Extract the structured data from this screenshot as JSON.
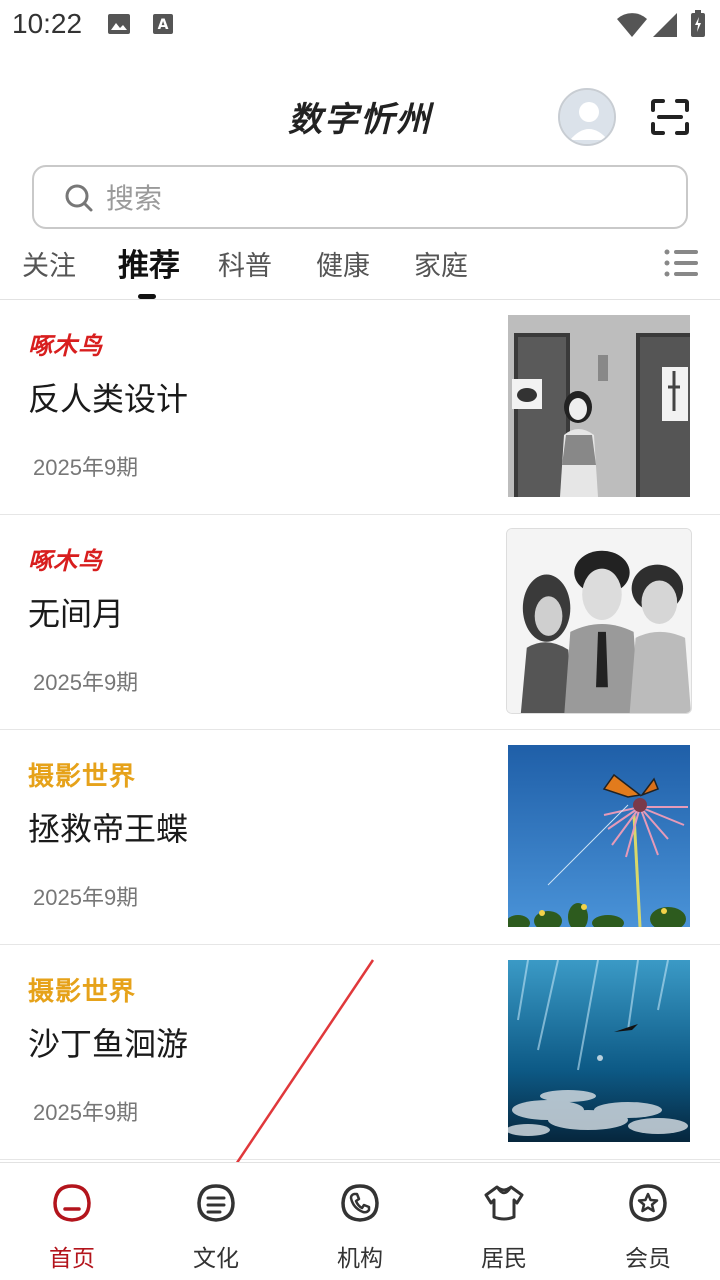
{
  "status_bar": {
    "time": "10:22",
    "icons": [
      "image-icon",
      "a-icon",
      "wifi-icon",
      "signal-icon",
      "battery-icon"
    ]
  },
  "header": {
    "title": "数字忻州",
    "avatar_icon": "avatar-icon",
    "scan_icon": "scan-icon"
  },
  "search": {
    "placeholder": "搜索"
  },
  "tabs": {
    "items": [
      {
        "label": "关注"
      },
      {
        "label": "推荐",
        "active": true
      },
      {
        "label": "科普"
      },
      {
        "label": "健康"
      },
      {
        "label": "家庭"
      }
    ],
    "menu_icon": "list-menu-icon"
  },
  "articles": [
    {
      "source": "啄木鸟",
      "title": "反人类设计",
      "date": "2025年9期"
    },
    {
      "source": "啄木鸟",
      "title": "无间月",
      "date": "2025年9期"
    },
    {
      "source": "摄影世界",
      "title": "拯救帝王蝶",
      "date": "2025年9期"
    },
    {
      "source": "摄影世界",
      "title": "沙丁鱼洄游",
      "date": "2025年9期"
    }
  ],
  "bottom_nav": {
    "items": [
      {
        "label": "首页",
        "icon": "home-icon",
        "active": true
      },
      {
        "label": "文化",
        "icon": "culture-icon"
      },
      {
        "label": "机构",
        "icon": "phone-icon"
      },
      {
        "label": "居民",
        "icon": "shirt-icon"
      },
      {
        "label": "会员",
        "icon": "star-badge-icon"
      }
    ]
  },
  "colors": {
    "accent": "#b3141c",
    "logo_red": "#d81e1e",
    "logo_gold": "#e6a21a",
    "annotation_arrow": "#e0383b"
  }
}
